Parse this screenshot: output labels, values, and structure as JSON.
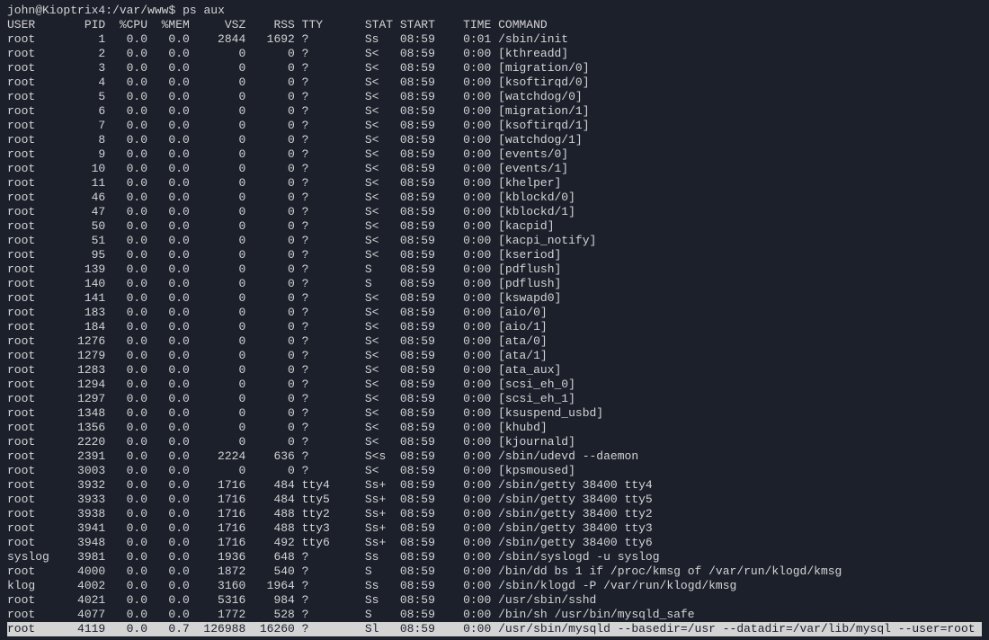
{
  "prompt": {
    "user_host": "john@Kioptrix4",
    "path": "/var/www",
    "separator1": ":",
    "separator2": "$",
    "command": "ps aux"
  },
  "headers": {
    "user": "USER",
    "pid": "PID",
    "cpu": "%CPU",
    "mem": "%MEM",
    "vsz": "VSZ",
    "rss": "RSS",
    "tty": "TTY",
    "stat": "STAT",
    "start": "START",
    "time": "TIME",
    "command": "COMMAND"
  },
  "processes": [
    {
      "user": "root",
      "pid": "1",
      "cpu": "0.0",
      "mem": "0.0",
      "vsz": "2844",
      "rss": "1692",
      "tty": "?",
      "stat": "Ss",
      "start": "08:59",
      "time": "0:01",
      "command": "/sbin/init"
    },
    {
      "user": "root",
      "pid": "2",
      "cpu": "0.0",
      "mem": "0.0",
      "vsz": "0",
      "rss": "0",
      "tty": "?",
      "stat": "S<",
      "start": "08:59",
      "time": "0:00",
      "command": "[kthreadd]"
    },
    {
      "user": "root",
      "pid": "3",
      "cpu": "0.0",
      "mem": "0.0",
      "vsz": "0",
      "rss": "0",
      "tty": "?",
      "stat": "S<",
      "start": "08:59",
      "time": "0:00",
      "command": "[migration/0]"
    },
    {
      "user": "root",
      "pid": "4",
      "cpu": "0.0",
      "mem": "0.0",
      "vsz": "0",
      "rss": "0",
      "tty": "?",
      "stat": "S<",
      "start": "08:59",
      "time": "0:00",
      "command": "[ksoftirqd/0]"
    },
    {
      "user": "root",
      "pid": "5",
      "cpu": "0.0",
      "mem": "0.0",
      "vsz": "0",
      "rss": "0",
      "tty": "?",
      "stat": "S<",
      "start": "08:59",
      "time": "0:00",
      "command": "[watchdog/0]"
    },
    {
      "user": "root",
      "pid": "6",
      "cpu": "0.0",
      "mem": "0.0",
      "vsz": "0",
      "rss": "0",
      "tty": "?",
      "stat": "S<",
      "start": "08:59",
      "time": "0:00",
      "command": "[migration/1]"
    },
    {
      "user": "root",
      "pid": "7",
      "cpu": "0.0",
      "mem": "0.0",
      "vsz": "0",
      "rss": "0",
      "tty": "?",
      "stat": "S<",
      "start": "08:59",
      "time": "0:00",
      "command": "[ksoftirqd/1]"
    },
    {
      "user": "root",
      "pid": "8",
      "cpu": "0.0",
      "mem": "0.0",
      "vsz": "0",
      "rss": "0",
      "tty": "?",
      "stat": "S<",
      "start": "08:59",
      "time": "0:00",
      "command": "[watchdog/1]"
    },
    {
      "user": "root",
      "pid": "9",
      "cpu": "0.0",
      "mem": "0.0",
      "vsz": "0",
      "rss": "0",
      "tty": "?",
      "stat": "S<",
      "start": "08:59",
      "time": "0:00",
      "command": "[events/0]"
    },
    {
      "user": "root",
      "pid": "10",
      "cpu": "0.0",
      "mem": "0.0",
      "vsz": "0",
      "rss": "0",
      "tty": "?",
      "stat": "S<",
      "start": "08:59",
      "time": "0:00",
      "command": "[events/1]"
    },
    {
      "user": "root",
      "pid": "11",
      "cpu": "0.0",
      "mem": "0.0",
      "vsz": "0",
      "rss": "0",
      "tty": "?",
      "stat": "S<",
      "start": "08:59",
      "time": "0:00",
      "command": "[khelper]"
    },
    {
      "user": "root",
      "pid": "46",
      "cpu": "0.0",
      "mem": "0.0",
      "vsz": "0",
      "rss": "0",
      "tty": "?",
      "stat": "S<",
      "start": "08:59",
      "time": "0:00",
      "command": "[kblockd/0]"
    },
    {
      "user": "root",
      "pid": "47",
      "cpu": "0.0",
      "mem": "0.0",
      "vsz": "0",
      "rss": "0",
      "tty": "?",
      "stat": "S<",
      "start": "08:59",
      "time": "0:00",
      "command": "[kblockd/1]"
    },
    {
      "user": "root",
      "pid": "50",
      "cpu": "0.0",
      "mem": "0.0",
      "vsz": "0",
      "rss": "0",
      "tty": "?",
      "stat": "S<",
      "start": "08:59",
      "time": "0:00",
      "command": "[kacpid]"
    },
    {
      "user": "root",
      "pid": "51",
      "cpu": "0.0",
      "mem": "0.0",
      "vsz": "0",
      "rss": "0",
      "tty": "?",
      "stat": "S<",
      "start": "08:59",
      "time": "0:00",
      "command": "[kacpi_notify]"
    },
    {
      "user": "root",
      "pid": "95",
      "cpu": "0.0",
      "mem": "0.0",
      "vsz": "0",
      "rss": "0",
      "tty": "?",
      "stat": "S<",
      "start": "08:59",
      "time": "0:00",
      "command": "[kseriod]"
    },
    {
      "user": "root",
      "pid": "139",
      "cpu": "0.0",
      "mem": "0.0",
      "vsz": "0",
      "rss": "0",
      "tty": "?",
      "stat": "S",
      "start": "08:59",
      "time": "0:00",
      "command": "[pdflush]"
    },
    {
      "user": "root",
      "pid": "140",
      "cpu": "0.0",
      "mem": "0.0",
      "vsz": "0",
      "rss": "0",
      "tty": "?",
      "stat": "S",
      "start": "08:59",
      "time": "0:00",
      "command": "[pdflush]"
    },
    {
      "user": "root",
      "pid": "141",
      "cpu": "0.0",
      "mem": "0.0",
      "vsz": "0",
      "rss": "0",
      "tty": "?",
      "stat": "S<",
      "start": "08:59",
      "time": "0:00",
      "command": "[kswapd0]"
    },
    {
      "user": "root",
      "pid": "183",
      "cpu": "0.0",
      "mem": "0.0",
      "vsz": "0",
      "rss": "0",
      "tty": "?",
      "stat": "S<",
      "start": "08:59",
      "time": "0:00",
      "command": "[aio/0]"
    },
    {
      "user": "root",
      "pid": "184",
      "cpu": "0.0",
      "mem": "0.0",
      "vsz": "0",
      "rss": "0",
      "tty": "?",
      "stat": "S<",
      "start": "08:59",
      "time": "0:00",
      "command": "[aio/1]"
    },
    {
      "user": "root",
      "pid": "1276",
      "cpu": "0.0",
      "mem": "0.0",
      "vsz": "0",
      "rss": "0",
      "tty": "?",
      "stat": "S<",
      "start": "08:59",
      "time": "0:00",
      "command": "[ata/0]"
    },
    {
      "user": "root",
      "pid": "1279",
      "cpu": "0.0",
      "mem": "0.0",
      "vsz": "0",
      "rss": "0",
      "tty": "?",
      "stat": "S<",
      "start": "08:59",
      "time": "0:00",
      "command": "[ata/1]"
    },
    {
      "user": "root",
      "pid": "1283",
      "cpu": "0.0",
      "mem": "0.0",
      "vsz": "0",
      "rss": "0",
      "tty": "?",
      "stat": "S<",
      "start": "08:59",
      "time": "0:00",
      "command": "[ata_aux]"
    },
    {
      "user": "root",
      "pid": "1294",
      "cpu": "0.0",
      "mem": "0.0",
      "vsz": "0",
      "rss": "0",
      "tty": "?",
      "stat": "S<",
      "start": "08:59",
      "time": "0:00",
      "command": "[scsi_eh_0]"
    },
    {
      "user": "root",
      "pid": "1297",
      "cpu": "0.0",
      "mem": "0.0",
      "vsz": "0",
      "rss": "0",
      "tty": "?",
      "stat": "S<",
      "start": "08:59",
      "time": "0:00",
      "command": "[scsi_eh_1]"
    },
    {
      "user": "root",
      "pid": "1348",
      "cpu": "0.0",
      "mem": "0.0",
      "vsz": "0",
      "rss": "0",
      "tty": "?",
      "stat": "S<",
      "start": "08:59",
      "time": "0:00",
      "command": "[ksuspend_usbd]"
    },
    {
      "user": "root",
      "pid": "1356",
      "cpu": "0.0",
      "mem": "0.0",
      "vsz": "0",
      "rss": "0",
      "tty": "?",
      "stat": "S<",
      "start": "08:59",
      "time": "0:00",
      "command": "[khubd]"
    },
    {
      "user": "root",
      "pid": "2220",
      "cpu": "0.0",
      "mem": "0.0",
      "vsz": "0",
      "rss": "0",
      "tty": "?",
      "stat": "S<",
      "start": "08:59",
      "time": "0:00",
      "command": "[kjournald]"
    },
    {
      "user": "root",
      "pid": "2391",
      "cpu": "0.0",
      "mem": "0.0",
      "vsz": "2224",
      "rss": "636",
      "tty": "?",
      "stat": "S<s",
      "start": "08:59",
      "time": "0:00",
      "command": "/sbin/udevd --daemon"
    },
    {
      "user": "root",
      "pid": "3003",
      "cpu": "0.0",
      "mem": "0.0",
      "vsz": "0",
      "rss": "0",
      "tty": "?",
      "stat": "S<",
      "start": "08:59",
      "time": "0:00",
      "command": "[kpsmoused]"
    },
    {
      "user": "root",
      "pid": "3932",
      "cpu": "0.0",
      "mem": "0.0",
      "vsz": "1716",
      "rss": "484",
      "tty": "tty4",
      "stat": "Ss+",
      "start": "08:59",
      "time": "0:00",
      "command": "/sbin/getty 38400 tty4"
    },
    {
      "user": "root",
      "pid": "3933",
      "cpu": "0.0",
      "mem": "0.0",
      "vsz": "1716",
      "rss": "484",
      "tty": "tty5",
      "stat": "Ss+",
      "start": "08:59",
      "time": "0:00",
      "command": "/sbin/getty 38400 tty5"
    },
    {
      "user": "root",
      "pid": "3938",
      "cpu": "0.0",
      "mem": "0.0",
      "vsz": "1716",
      "rss": "488",
      "tty": "tty2",
      "stat": "Ss+",
      "start": "08:59",
      "time": "0:00",
      "command": "/sbin/getty 38400 tty2"
    },
    {
      "user": "root",
      "pid": "3941",
      "cpu": "0.0",
      "mem": "0.0",
      "vsz": "1716",
      "rss": "488",
      "tty": "tty3",
      "stat": "Ss+",
      "start": "08:59",
      "time": "0:00",
      "command": "/sbin/getty 38400 tty3"
    },
    {
      "user": "root",
      "pid": "3948",
      "cpu": "0.0",
      "mem": "0.0",
      "vsz": "1716",
      "rss": "492",
      "tty": "tty6",
      "stat": "Ss+",
      "start": "08:59",
      "time": "0:00",
      "command": "/sbin/getty 38400 tty6"
    },
    {
      "user": "syslog",
      "pid": "3981",
      "cpu": "0.0",
      "mem": "0.0",
      "vsz": "1936",
      "rss": "648",
      "tty": "?",
      "stat": "Ss",
      "start": "08:59",
      "time": "0:00",
      "command": "/sbin/syslogd -u syslog"
    },
    {
      "user": "root",
      "pid": "4000",
      "cpu": "0.0",
      "mem": "0.0",
      "vsz": "1872",
      "rss": "540",
      "tty": "?",
      "stat": "S",
      "start": "08:59",
      "time": "0:00",
      "command": "/bin/dd bs 1 if /proc/kmsg of /var/run/klogd/kmsg"
    },
    {
      "user": "klog",
      "pid": "4002",
      "cpu": "0.0",
      "mem": "0.0",
      "vsz": "3160",
      "rss": "1964",
      "tty": "?",
      "stat": "Ss",
      "start": "08:59",
      "time": "0:00",
      "command": "/sbin/klogd -P /var/run/klogd/kmsg"
    },
    {
      "user": "root",
      "pid": "4021",
      "cpu": "0.0",
      "mem": "0.0",
      "vsz": "5316",
      "rss": "984",
      "tty": "?",
      "stat": "Ss",
      "start": "08:59",
      "time": "0:00",
      "command": "/usr/sbin/sshd"
    },
    {
      "user": "root",
      "pid": "4077",
      "cpu": "0.0",
      "mem": "0.0",
      "vsz": "1772",
      "rss": "528",
      "tty": "?",
      "stat": "S",
      "start": "08:59",
      "time": "0:00",
      "command": "/bin/sh /usr/bin/mysqld_safe"
    },
    {
      "user": "root",
      "pid": "4119",
      "cpu": "0.0",
      "mem": "0.7",
      "vsz": "126988",
      "rss": "16260",
      "tty": "?",
      "stat": "Sl",
      "start": "08:59",
      "time": "0:00",
      "command": "/usr/sbin/mysqld --basedir=/usr --datadir=/var/lib/mysql --user=root --",
      "highlighted": true
    }
  ]
}
